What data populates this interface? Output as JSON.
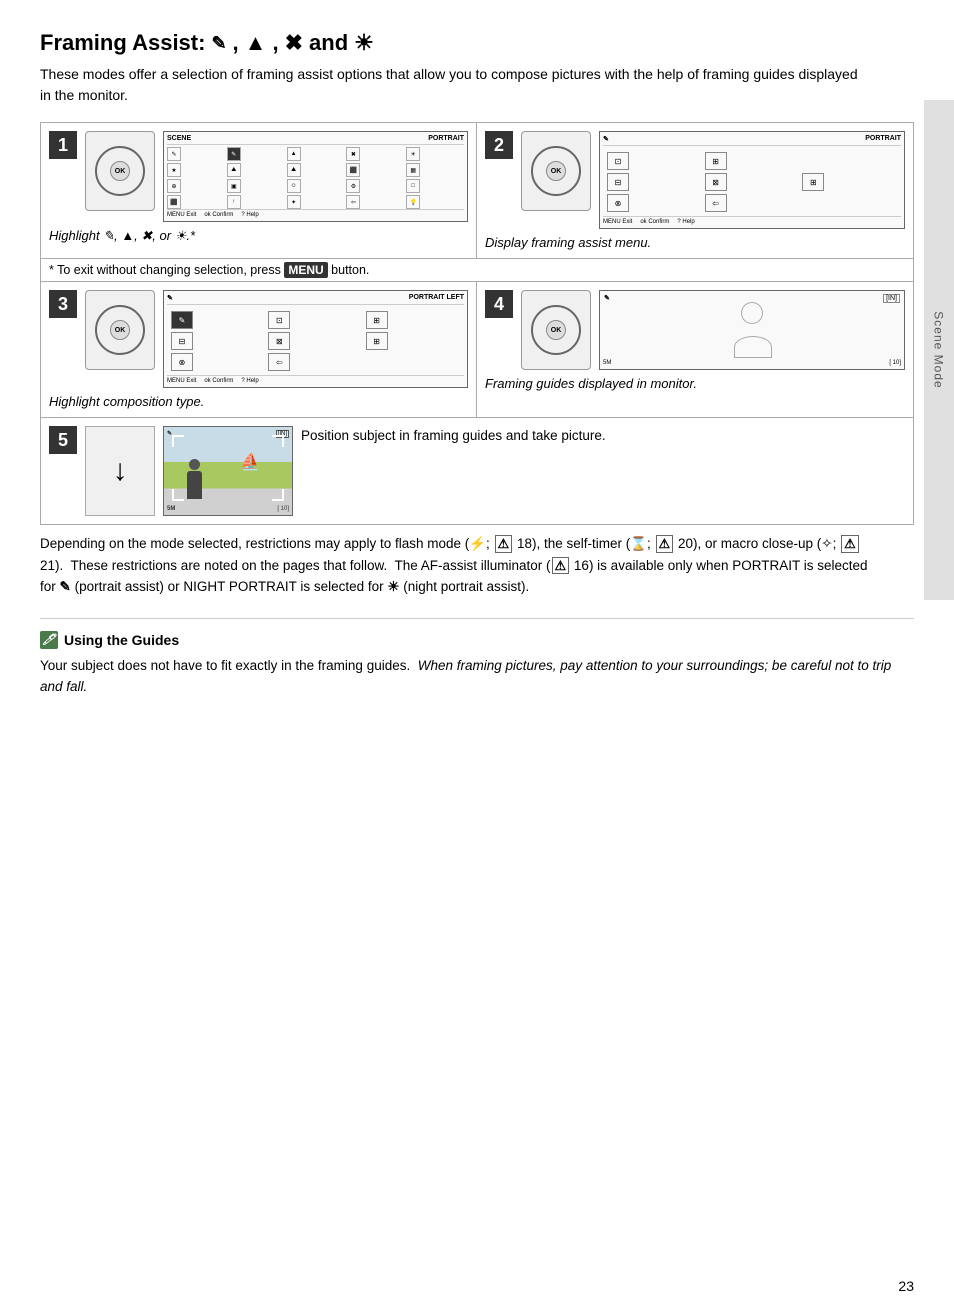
{
  "page": {
    "title_prefix": "Framing Assist:",
    "title_suffix": "and",
    "intro": "These modes offer a selection of framing assist options that allow you to compose pictures with the help of framing guides displayed in the monitor.",
    "note": "* To exit without changing selection, press",
    "note_button": "MENU",
    "note_suffix": "button.",
    "steps": [
      {
        "number": "1",
        "caption": "Highlight",
        "caption_suffix": ", or",
        "screen_label": "SCENE",
        "screen_mode": "PORTRAIT",
        "screen_bottom": "Exit  ok Confirm  ? Help"
      },
      {
        "number": "2",
        "caption": "Display framing assist menu.",
        "screen_mode": "PORTRAIT",
        "screen_bottom": "Exit  ok Confirm  ? Help"
      },
      {
        "number": "3",
        "caption": "Highlight composition type.",
        "screen_mode": "PORTRAIT LEFT",
        "screen_bottom": "Exit  ok Confirm  ? Help"
      },
      {
        "number": "4",
        "caption": "Framing guides displayed in monitor.",
        "screen_bottom": "5M    10"
      },
      {
        "number": "5",
        "caption": "Position subject in framing guides and take picture.",
        "screen_bottom": "5M    10"
      }
    ],
    "desc": "Depending on the mode selected, restrictions may apply to flash mode (⚡; 18), the self-timer (⌛; 20), or macro close-up (❧; 21).  These restrictions are noted on the pages that follow.  The AF-assist illuminator ( 16) is available only when PORTRAIT is selected for  (portrait assist) or NIGHT PORTRAIT is selected for  (night portrait assist).",
    "guides_title": "Using the Guides",
    "guides_text": "Your subject does not have to fit exactly in the framing guides.",
    "guides_italic": "When framing pictures, pay attention to your surroundings; be careful not to trip and fall.",
    "page_number": "23",
    "side_label": "Scene Mode"
  }
}
